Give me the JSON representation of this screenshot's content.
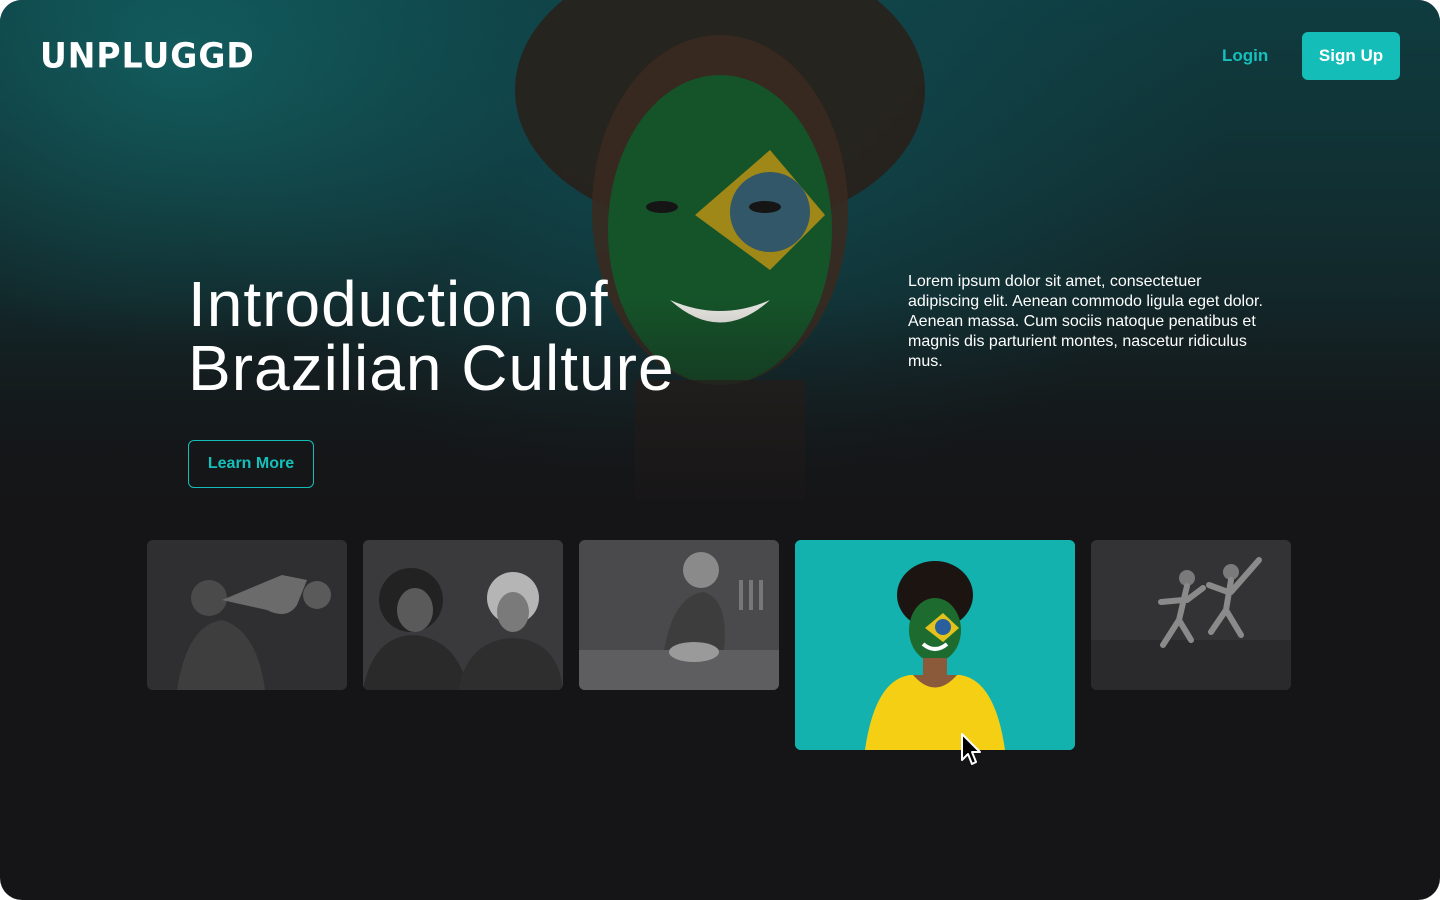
{
  "brand": {
    "logo": "UNPLUGGD"
  },
  "nav": {
    "login_label": "Login",
    "signup_label": "Sign Up"
  },
  "hero": {
    "title_line1": "Introduction of",
    "title_line2": "Brazilian Culture",
    "description": "Lorem ipsum dolor sit amet, consectetuer adipiscing elit. Aenean commodo ligula eget dolor. Aenean massa. Cum sociis natoque penatibus et magnis dis parturient montes, nascetur ridiculus mus.",
    "cta_label": "Learn More"
  },
  "gallery": {
    "items": [
      {
        "subject": "saxophone player",
        "selected": false
      },
      {
        "subject": "two women illustration",
        "selected": false
      },
      {
        "subject": "woman cooking",
        "selected": false
      },
      {
        "subject": "woman with brazil flag face paint",
        "selected": true
      },
      {
        "subject": "dancers",
        "selected": false
      }
    ]
  },
  "colors": {
    "accent": "#14bdb8",
    "background": "#151517",
    "hero_teal": "#113033",
    "text": "#ffffff"
  },
  "icons": {
    "cursor": "mouse-pointer-icon"
  }
}
